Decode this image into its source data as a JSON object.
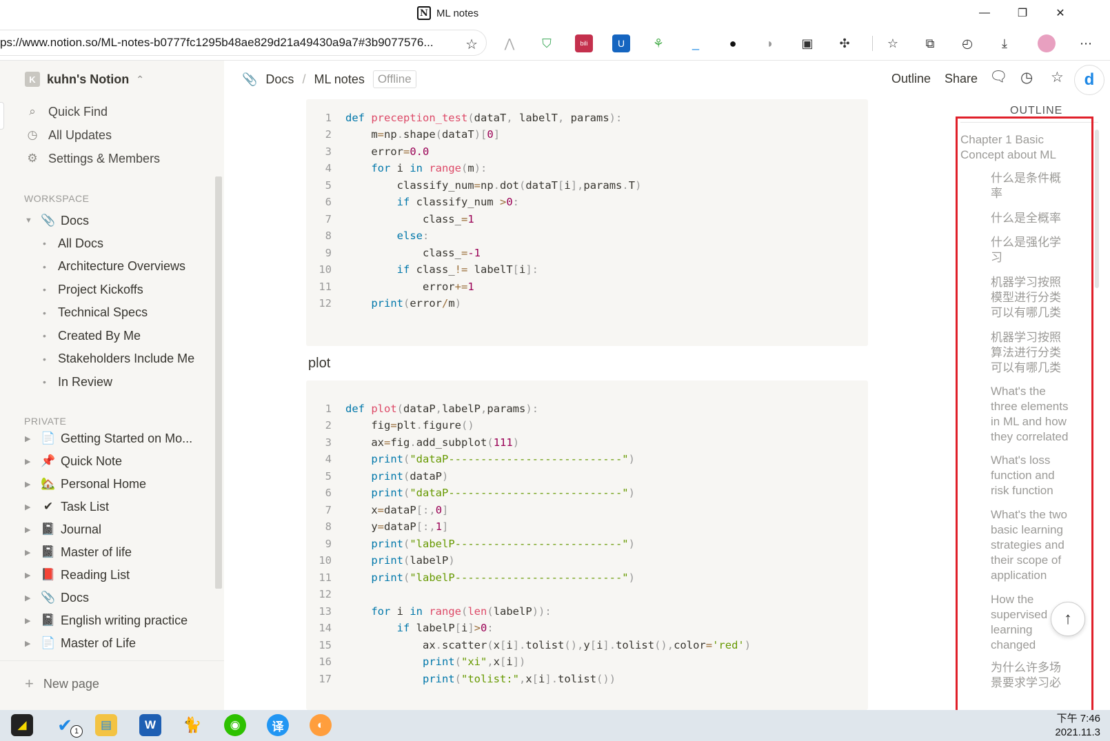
{
  "window": {
    "title": "ML notes",
    "minimize": "—",
    "maximize": "❐",
    "close": "✕"
  },
  "browser": {
    "url": "ps://www.notion.so/ML-notes-b0777fc1295b48ae829d21a49430a9a7#3b9077576...",
    "favorite_icon": "☆"
  },
  "sidebar": {
    "workspace_initial": "K",
    "workspace_name": "kuhn's Notion",
    "workspace_caret": "⌃",
    "nav": [
      {
        "label": "Quick Find",
        "icon": "search-icon",
        "glyph": "⌕"
      },
      {
        "label": "All Updates",
        "icon": "clock-icon",
        "glyph": "◷"
      },
      {
        "label": "Settings & Members",
        "icon": "gear-icon",
        "glyph": "⚙"
      }
    ],
    "workspace_section": "WORKSPACE",
    "docs_label": "Docs",
    "docs_icon": "📎",
    "docs_children": [
      "All Docs",
      "Architecture Overviews",
      "Project Kickoffs",
      "Technical Specs",
      "Created By Me",
      "Stakeholders Include Me",
      "In Review"
    ],
    "private_section": "PRIVATE",
    "private_pages": [
      {
        "label": "Getting Started on Mo...",
        "icon": "📄"
      },
      {
        "label": "Quick Note",
        "icon": "📌"
      },
      {
        "label": "Personal Home",
        "icon": "🏡"
      },
      {
        "label": "Task List",
        "icon": "✔"
      },
      {
        "label": "Journal",
        "icon": "📓"
      },
      {
        "label": "Master of life",
        "icon": "📓"
      },
      {
        "label": "Reading List",
        "icon": "📕"
      },
      {
        "label": "Docs",
        "icon": "📎"
      },
      {
        "label": "English writing practice",
        "icon": "📓"
      },
      {
        "label": "Master of Life",
        "icon": "📄"
      }
    ],
    "new_page": "New page",
    "new_page_icon": "+"
  },
  "topbar": {
    "breadcrumb": [
      "Docs",
      "ML notes"
    ],
    "breadcrumb_sep": "/",
    "offline_badge": "Offline",
    "outline": "Outline",
    "share": "Share"
  },
  "code_block_1": {
    "lines": [
      [
        [
          "kw",
          "def "
        ],
        [
          "fn",
          "preception_test"
        ],
        [
          "pn",
          "("
        ],
        [
          "",
          "dataT"
        ],
        [
          "pn",
          ", "
        ],
        [
          "",
          "labelT"
        ],
        [
          "pn",
          ", "
        ],
        [
          "",
          "params"
        ],
        [
          "pn",
          "):"
        ]
      ],
      [
        [
          "",
          "    m"
        ],
        [
          "op",
          "="
        ],
        [
          "",
          "np"
        ],
        [
          "pn",
          "."
        ],
        [
          "",
          "shape"
        ],
        [
          "pn",
          "("
        ],
        [
          "",
          "dataT"
        ],
        [
          "pn",
          ")["
        ],
        [
          "num",
          "0"
        ],
        [
          "pn",
          "]"
        ]
      ],
      [
        [
          "",
          "    error"
        ],
        [
          "op",
          "="
        ],
        [
          "num",
          "0.0"
        ]
      ],
      [
        [
          "kw",
          "    for "
        ],
        [
          "",
          "i "
        ],
        [
          "kw",
          "in "
        ],
        [
          "fn",
          "range"
        ],
        [
          "pn",
          "("
        ],
        [
          "",
          "m"
        ],
        [
          "pn",
          "):"
        ]
      ],
      [
        [
          "",
          "        classify_num"
        ],
        [
          "op",
          "="
        ],
        [
          "",
          "np"
        ],
        [
          "pn",
          "."
        ],
        [
          "",
          "dot"
        ],
        [
          "pn",
          "("
        ],
        [
          "",
          "dataT"
        ],
        [
          "pn",
          "["
        ],
        [
          "",
          "i"
        ],
        [
          "pn",
          "],"
        ],
        [
          "",
          "params"
        ],
        [
          "pn",
          "."
        ],
        [
          "",
          "T"
        ],
        [
          "pn",
          ")"
        ]
      ],
      [
        [
          "kw",
          "        if "
        ],
        [
          "",
          "classify_num "
        ],
        [
          "op",
          ">"
        ],
        [
          "num",
          "0"
        ],
        [
          "pn",
          ":"
        ]
      ],
      [
        [
          "",
          "            class_"
        ],
        [
          "op",
          "="
        ],
        [
          "num",
          "1"
        ]
      ],
      [
        [
          "kw",
          "        else"
        ],
        [
          "pn",
          ":"
        ]
      ],
      [
        [
          "",
          "            class_"
        ],
        [
          "op",
          "="
        ],
        [
          "num",
          "-1"
        ]
      ],
      [
        [
          "kw",
          "        if "
        ],
        [
          "",
          "class_"
        ],
        [
          "op",
          "!= "
        ],
        [
          "",
          "labelT"
        ],
        [
          "pn",
          "["
        ],
        [
          "",
          "i"
        ],
        [
          "pn",
          "]:"
        ]
      ],
      [
        [
          "",
          "            error"
        ],
        [
          "op",
          "+="
        ],
        [
          "num",
          "1"
        ]
      ],
      [
        [
          "kw",
          "    print"
        ],
        [
          "pn",
          "("
        ],
        [
          "",
          "error"
        ],
        [
          "op",
          "/"
        ],
        [
          "",
          "m"
        ],
        [
          "pn",
          ")"
        ]
      ]
    ]
  },
  "plot_heading": "plot",
  "code_block_2": {
    "lines": [
      [
        [
          "kw",
          "def "
        ],
        [
          "fn",
          "plot"
        ],
        [
          "pn",
          "("
        ],
        [
          "",
          "dataP"
        ],
        [
          "pn",
          ","
        ],
        [
          "",
          "labelP"
        ],
        [
          "pn",
          ","
        ],
        [
          "",
          "params"
        ],
        [
          "pn",
          "):"
        ]
      ],
      [
        [
          "",
          "    fig"
        ],
        [
          "op",
          "="
        ],
        [
          "",
          "plt"
        ],
        [
          "pn",
          "."
        ],
        [
          "",
          "figure"
        ],
        [
          "pn",
          "()"
        ]
      ],
      [
        [
          "",
          "    ax"
        ],
        [
          "op",
          "="
        ],
        [
          "",
          "fig"
        ],
        [
          "pn",
          "."
        ],
        [
          "",
          "add_subplot"
        ],
        [
          "pn",
          "("
        ],
        [
          "num",
          "111"
        ],
        [
          "pn",
          ")"
        ]
      ],
      [
        [
          "kw",
          "    print"
        ],
        [
          "pn",
          "("
        ],
        [
          "str",
          "\"dataP---------------------------\""
        ],
        [
          "pn",
          ")"
        ]
      ],
      [
        [
          "kw",
          "    print"
        ],
        [
          "pn",
          "("
        ],
        [
          "",
          "dataP"
        ],
        [
          "pn",
          ")"
        ]
      ],
      [
        [
          "kw",
          "    print"
        ],
        [
          "pn",
          "("
        ],
        [
          "str",
          "\"dataP---------------------------\""
        ],
        [
          "pn",
          ")"
        ]
      ],
      [
        [
          "",
          "    x"
        ],
        [
          "op",
          "="
        ],
        [
          "",
          "dataP"
        ],
        [
          "pn",
          "[:,"
        ],
        [
          "num",
          "0"
        ],
        [
          "pn",
          "]"
        ]
      ],
      [
        [
          "",
          "    y"
        ],
        [
          "op",
          "="
        ],
        [
          "",
          "dataP"
        ],
        [
          "pn",
          "[:,"
        ],
        [
          "num",
          "1"
        ],
        [
          "pn",
          "]"
        ]
      ],
      [
        [
          "kw",
          "    print"
        ],
        [
          "pn",
          "("
        ],
        [
          "str",
          "\"labelP--------------------------\""
        ],
        [
          "pn",
          ")"
        ]
      ],
      [
        [
          "kw",
          "    print"
        ],
        [
          "pn",
          "("
        ],
        [
          "",
          "labelP"
        ],
        [
          "pn",
          ")"
        ]
      ],
      [
        [
          "kw",
          "    print"
        ],
        [
          "pn",
          "("
        ],
        [
          "str",
          "\"labelP--------------------------\""
        ],
        [
          "pn",
          ")"
        ]
      ],
      [],
      [
        [
          "kw",
          "    for "
        ],
        [
          "",
          "i "
        ],
        [
          "kw",
          "in "
        ],
        [
          "fn",
          "range"
        ],
        [
          "pn",
          "("
        ],
        [
          "fn",
          "len"
        ],
        [
          "pn",
          "("
        ],
        [
          "",
          "labelP"
        ],
        [
          "pn",
          "))"
        ],
        [
          "pn",
          ":"
        ]
      ],
      [
        [
          "kw",
          "        if "
        ],
        [
          "",
          "labelP"
        ],
        [
          "pn",
          "["
        ],
        [
          "",
          "i"
        ],
        [
          "pn",
          "]"
        ],
        [
          "op",
          ">"
        ],
        [
          "num",
          "0"
        ],
        [
          "pn",
          ":"
        ]
      ],
      [
        [
          "",
          "            ax"
        ],
        [
          "pn",
          "."
        ],
        [
          "",
          "scatter"
        ],
        [
          "pn",
          "("
        ],
        [
          "",
          "x"
        ],
        [
          "pn",
          "["
        ],
        [
          "",
          "i"
        ],
        [
          "pn",
          "]."
        ],
        [
          "",
          "tolist"
        ],
        [
          "pn",
          "(),"
        ],
        [
          "",
          "y"
        ],
        [
          "pn",
          "["
        ],
        [
          "",
          "i"
        ],
        [
          "pn",
          "]."
        ],
        [
          "",
          "tolist"
        ],
        [
          "pn",
          "(),"
        ],
        [
          "",
          "color"
        ],
        [
          "op",
          "="
        ],
        [
          "str",
          "'red'"
        ],
        [
          "pn",
          ")"
        ]
      ],
      [
        [
          "kw",
          "            print"
        ],
        [
          "pn",
          "("
        ],
        [
          "str",
          "\"xi\""
        ],
        [
          "pn",
          ","
        ],
        [
          "",
          "x"
        ],
        [
          "pn",
          "["
        ],
        [
          "",
          "i"
        ],
        [
          "pn",
          "])"
        ]
      ],
      [
        [
          "kw",
          "            print"
        ],
        [
          "pn",
          "("
        ],
        [
          "str",
          "\"tolist:\""
        ],
        [
          "pn",
          ","
        ],
        [
          "",
          "x"
        ],
        [
          "pn",
          "["
        ],
        [
          "",
          "i"
        ],
        [
          "pn",
          "]."
        ],
        [
          "",
          "tolist"
        ],
        [
          "pn",
          "())"
        ]
      ]
    ]
  },
  "outline_panel": {
    "title": "OUTLINE",
    "items": [
      {
        "text": "Chapter 1 Basic\nConcept about ML",
        "level": 1
      },
      {
        "text": "什么是条件概\n率",
        "level": 2
      },
      {
        "text": "什么是全概率",
        "level": 2
      },
      {
        "text": "什么是强化学\n习",
        "level": 2
      },
      {
        "text": "机器学习按照\n模型进行分类\n可以有哪几类",
        "level": 2
      },
      {
        "text": "机器学习按照\n算法进行分类\n可以有哪几类",
        "level": 2
      },
      {
        "text": "What's the\nthree elements\nin ML and how\nthey correlated",
        "level": 2
      },
      {
        "text": "What's loss\nfunction and\nrisk function",
        "level": 2
      },
      {
        "text": "What's the two\nbasic learning\nstrategies and\ntheir scope of\napplication",
        "level": 2
      },
      {
        "text": "How the\nsupervised\nlearning\nchanged",
        "level": 2
      },
      {
        "text": "为什么许多场\n景要求学习必",
        "level": 2
      }
    ],
    "scroll_top": "↑"
  },
  "taskbar": {
    "time": "下午 7:46",
    "date": "2021.11.3",
    "badge": "1"
  }
}
